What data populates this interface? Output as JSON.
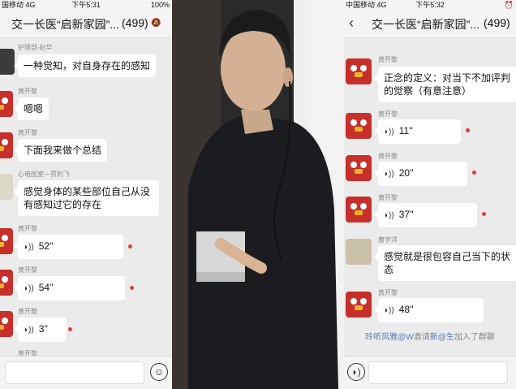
{
  "left": {
    "status": {
      "carrier": "国移动 4G",
      "time": "下午5:31",
      "battery": "100%"
    },
    "title": "交一长医“启新家园”...",
    "member_count": "(499)",
    "messages": [
      {
        "sender": "护理部-赵华",
        "text": "一种觉知，对自身存在的感知"
      },
      {
        "sender": "黄开黎",
        "text": "嗯嗯"
      },
      {
        "sender": "黄开黎",
        "text": "下面我来做个总结"
      },
      {
        "sender": "心电图室—贾利飞",
        "text": "感觉身体的某些部位自己从没有感知过它的存在"
      },
      {
        "sender": "黄开黎",
        "duration": "52''"
      },
      {
        "sender": "黄开黎",
        "duration": "54''"
      },
      {
        "sender": "黄开黎",
        "duration": "3''"
      },
      {
        "sender": "黄开黎"
      }
    ]
  },
  "right": {
    "status": {
      "carrier": "中国移动 4G",
      "time": "下午5:32"
    },
    "title": "交一长医“启新家园”...",
    "member_count": "(499)",
    "messages": [
      {
        "sender": "黄开黎",
        "text": "正念的定义：对当下不加评判的觉察（有意注意）"
      },
      {
        "sender": "黄开黎",
        "duration": "11''"
      },
      {
        "sender": "黄开黎",
        "duration": "20''"
      },
      {
        "sender": "黄开黎",
        "duration": "37''"
      },
      {
        "sender": "曹宇洋",
        "text": "感觉就是很包容自己当下的状态"
      },
      {
        "sender": "黄开黎",
        "duration": "48''"
      }
    ],
    "system": {
      "inviter": "玲听风雅@W",
      "verb": "邀请",
      "invitee": "新@生",
      "suffix": "加入了群聊"
    }
  },
  "icons": {
    "voice": "voice-wave-icon",
    "emoji": "emoji-icon",
    "back": "back-chevron-icon",
    "mute": "mute-bell-icon"
  },
  "colors": {
    "unread_dot": "#e33c3c",
    "chat_bg": "#ebebeb",
    "link": "#5a7ab6"
  }
}
